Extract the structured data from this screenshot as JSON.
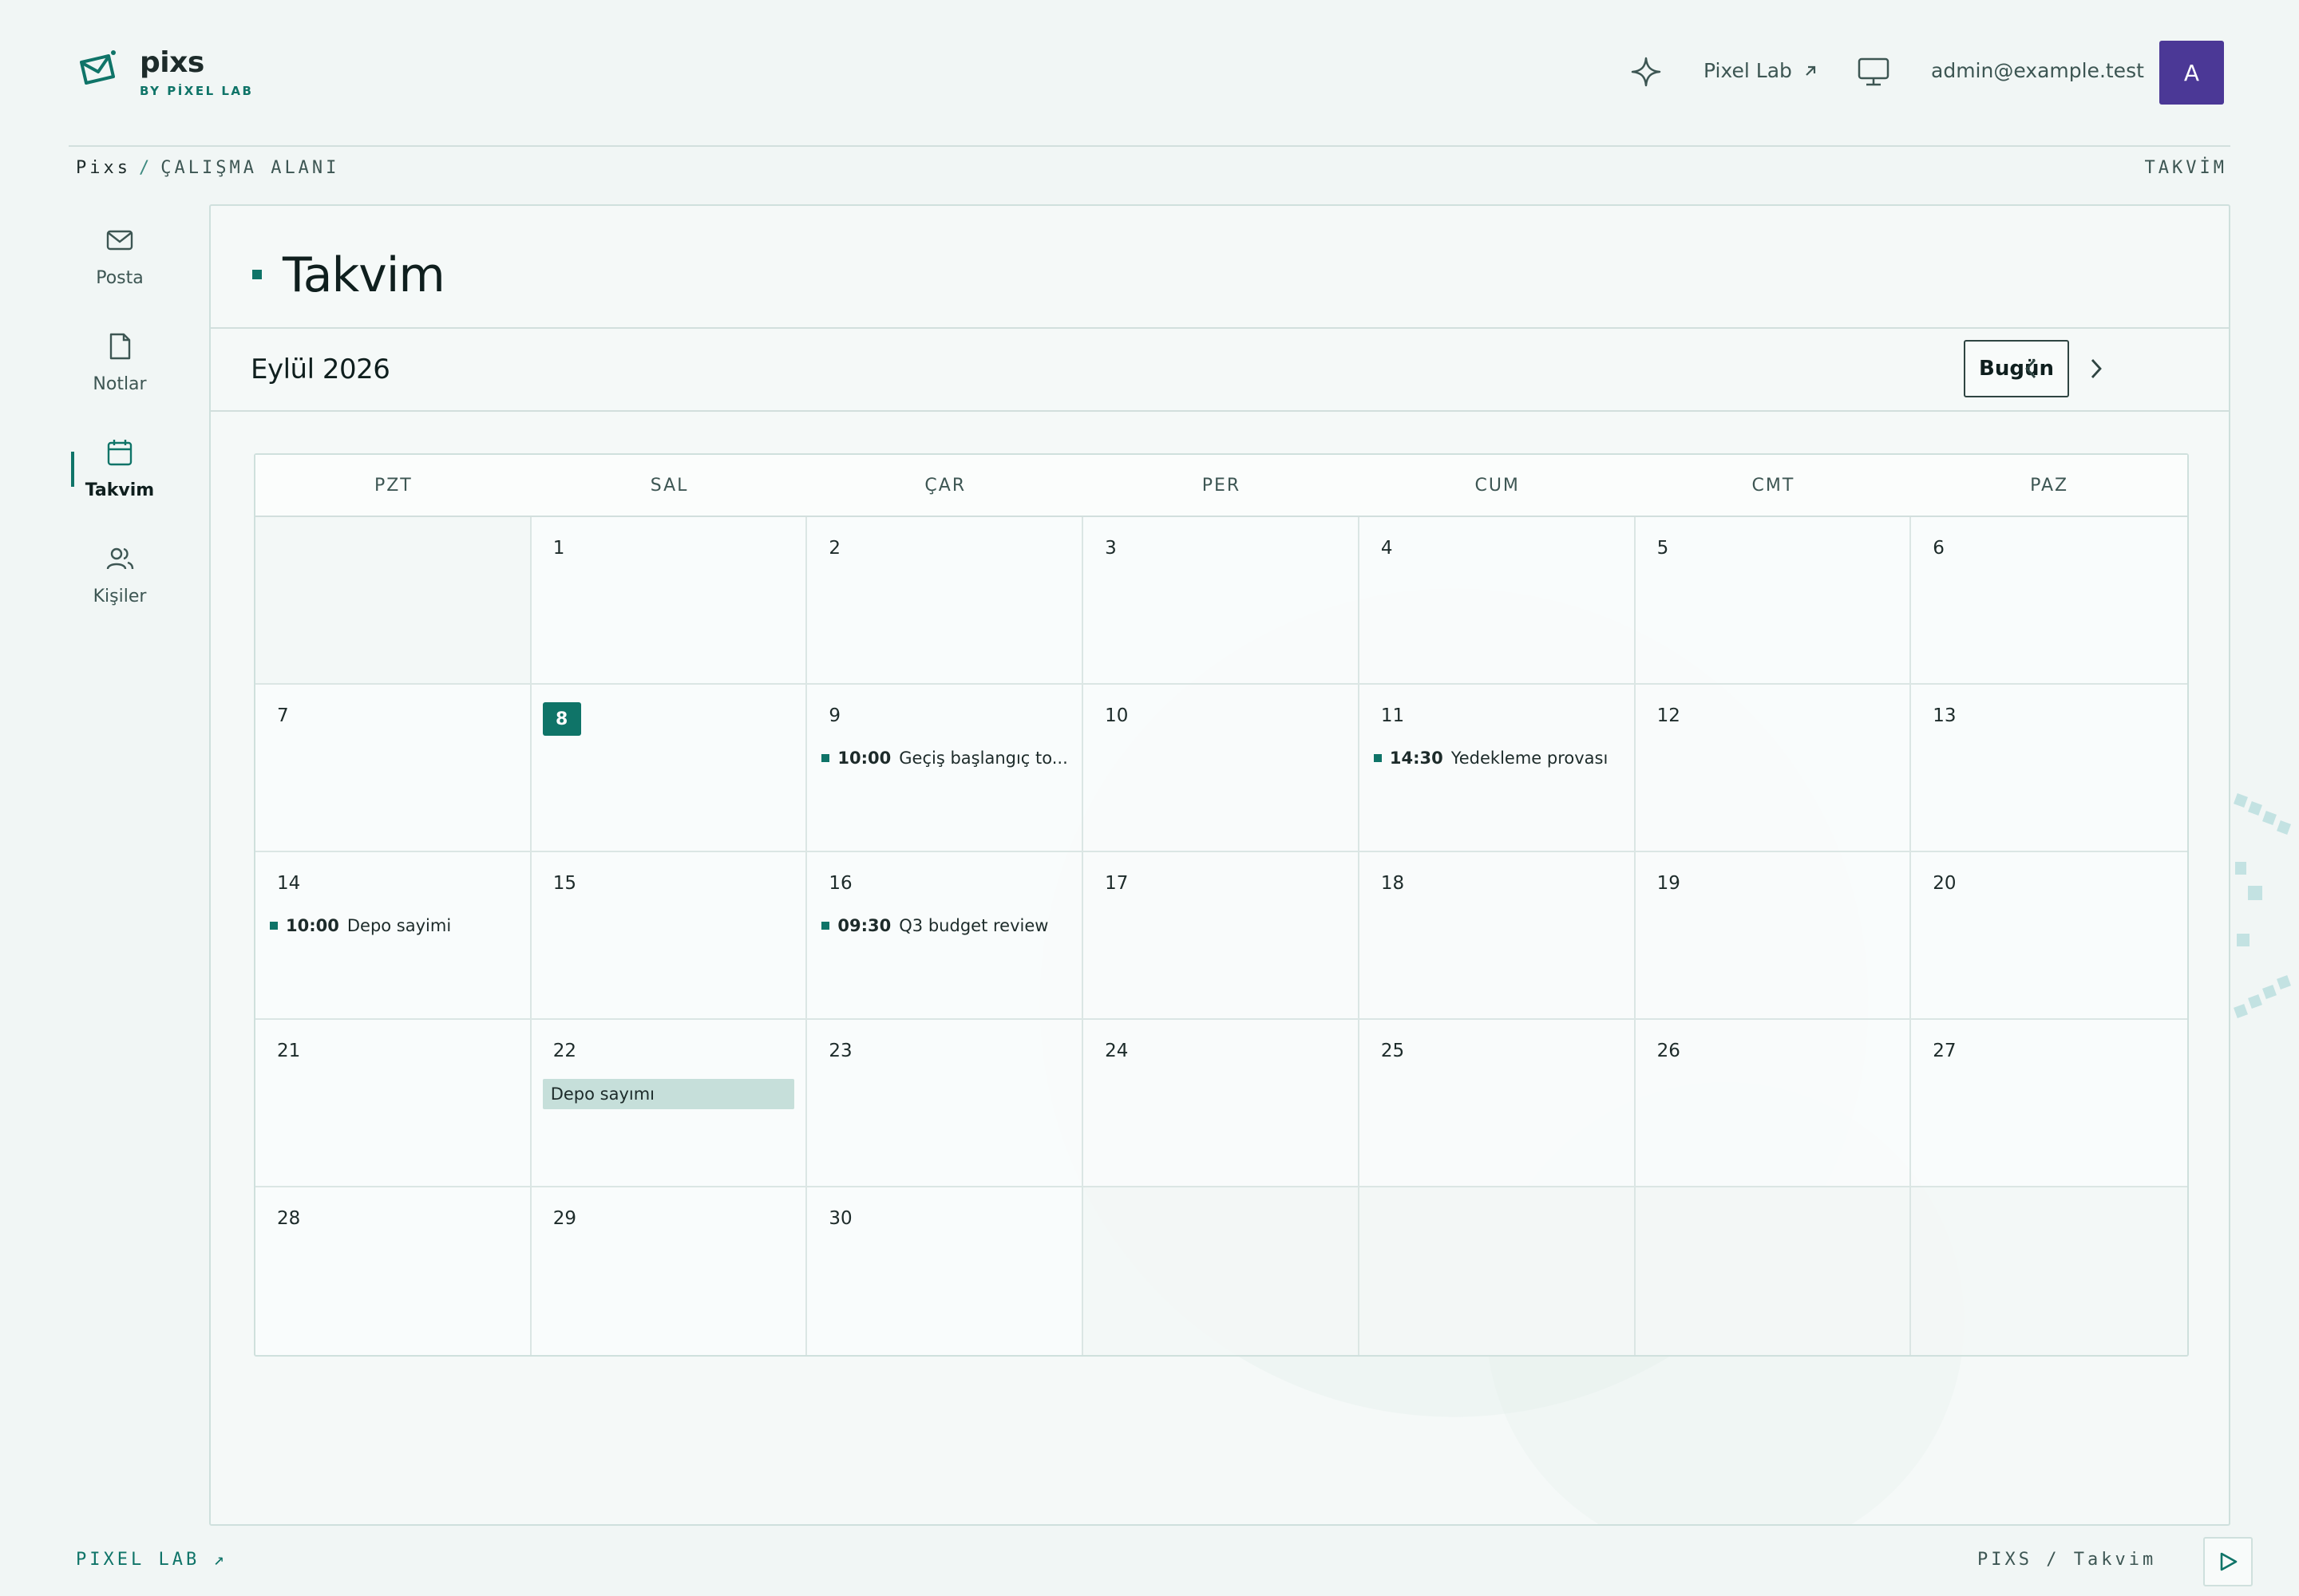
{
  "header": {
    "brand_name": "pixs",
    "brand_sub": "BY PİXEL LAB",
    "link_label": "Pixel Lab",
    "user_email": "admin@example.test",
    "avatar_initial": "A"
  },
  "breadcrumb": {
    "root": "Pixs",
    "separator": "/",
    "current": "ÇALIŞMA ALANI",
    "right_label": "TAKVİM"
  },
  "sidebar": {
    "items": [
      {
        "label": "Posta",
        "icon": "mail-icon"
      },
      {
        "label": "Notlar",
        "icon": "note-icon"
      },
      {
        "label": "Takvim",
        "icon": "calendar-icon",
        "active": true
      },
      {
        "label": "Kişiler",
        "icon": "users-icon"
      }
    ]
  },
  "main": {
    "title": "Takvim",
    "month_label": "Eylül 2026",
    "today_button": "Bugün"
  },
  "calendar": {
    "weekdays": [
      "PZT",
      "SAL",
      "ÇAR",
      "PER",
      "CUM",
      "CMT",
      "PAZ"
    ],
    "today": "8",
    "days": [
      "",
      "1",
      "2",
      "3",
      "4",
      "5",
      "6",
      "7",
      "8",
      "9",
      "10",
      "11",
      "12",
      "13",
      "14",
      "15",
      "16",
      "17",
      "18",
      "19",
      "20",
      "21",
      "22",
      "23",
      "24",
      "25",
      "26",
      "27",
      "28",
      "29",
      "30",
      "",
      "",
      "",
      ""
    ],
    "events": [
      {
        "day": "9",
        "time": "10:00",
        "title": "Geçiş başlangıç to..."
      },
      {
        "day": "11",
        "time": "14:30",
        "title": "Yedekleme provası"
      },
      {
        "day": "14",
        "time": "10:00",
        "title": "Depo sayimi"
      },
      {
        "day": "16",
        "time": "09:30",
        "title": "Q3 budget review"
      }
    ],
    "all_day_events": [
      {
        "day": "22",
        "title": "Depo sayımı"
      }
    ]
  },
  "footer": {
    "left_label": "PIXEL LAB ↗",
    "right_label": "PIXS / Takvim"
  },
  "colors": {
    "accent": "#0f7468",
    "avatar_bg": "#4b3896",
    "allday_bg": "#c6dfda"
  }
}
